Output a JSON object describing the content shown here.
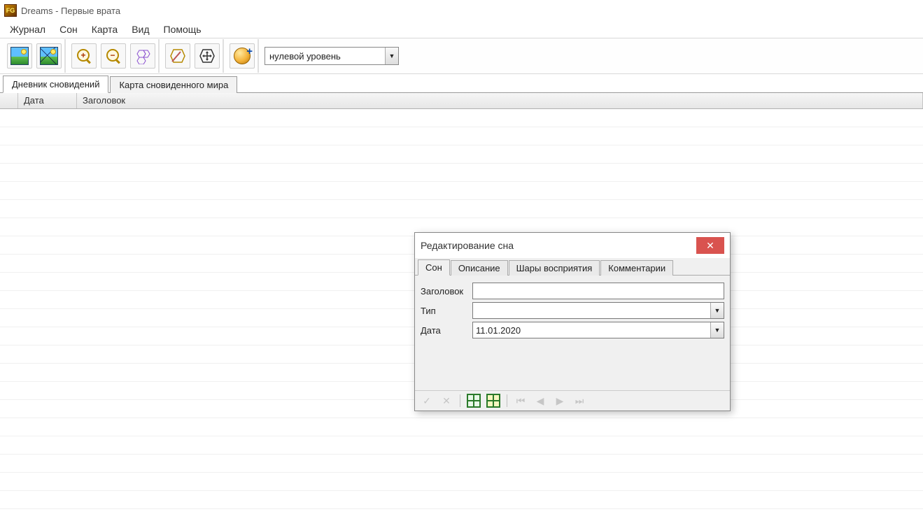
{
  "app": {
    "title": "Dreams - Первые врата"
  },
  "menu": {
    "items": [
      "Журнал",
      "Сон",
      "Карта",
      "Вид",
      "Помощь"
    ]
  },
  "toolbar": {
    "level_combo": "нулевой уровень"
  },
  "tabs": {
    "items": [
      "Дневник сновидений",
      "Карта сновиденного мира"
    ],
    "active": 0
  },
  "grid": {
    "columns": {
      "date": "Дата",
      "title": "Заголовок"
    }
  },
  "dialog": {
    "title": "Редактирование сна",
    "tabs": [
      "Сон",
      "Описание",
      "Шары восприятия",
      "Комментарии"
    ],
    "active_tab": 0,
    "form": {
      "title_label": "Заголовок",
      "title_value": "",
      "type_label": "Тип",
      "type_value": "",
      "date_label": "Дата",
      "date_value": "11.01.2020"
    }
  }
}
